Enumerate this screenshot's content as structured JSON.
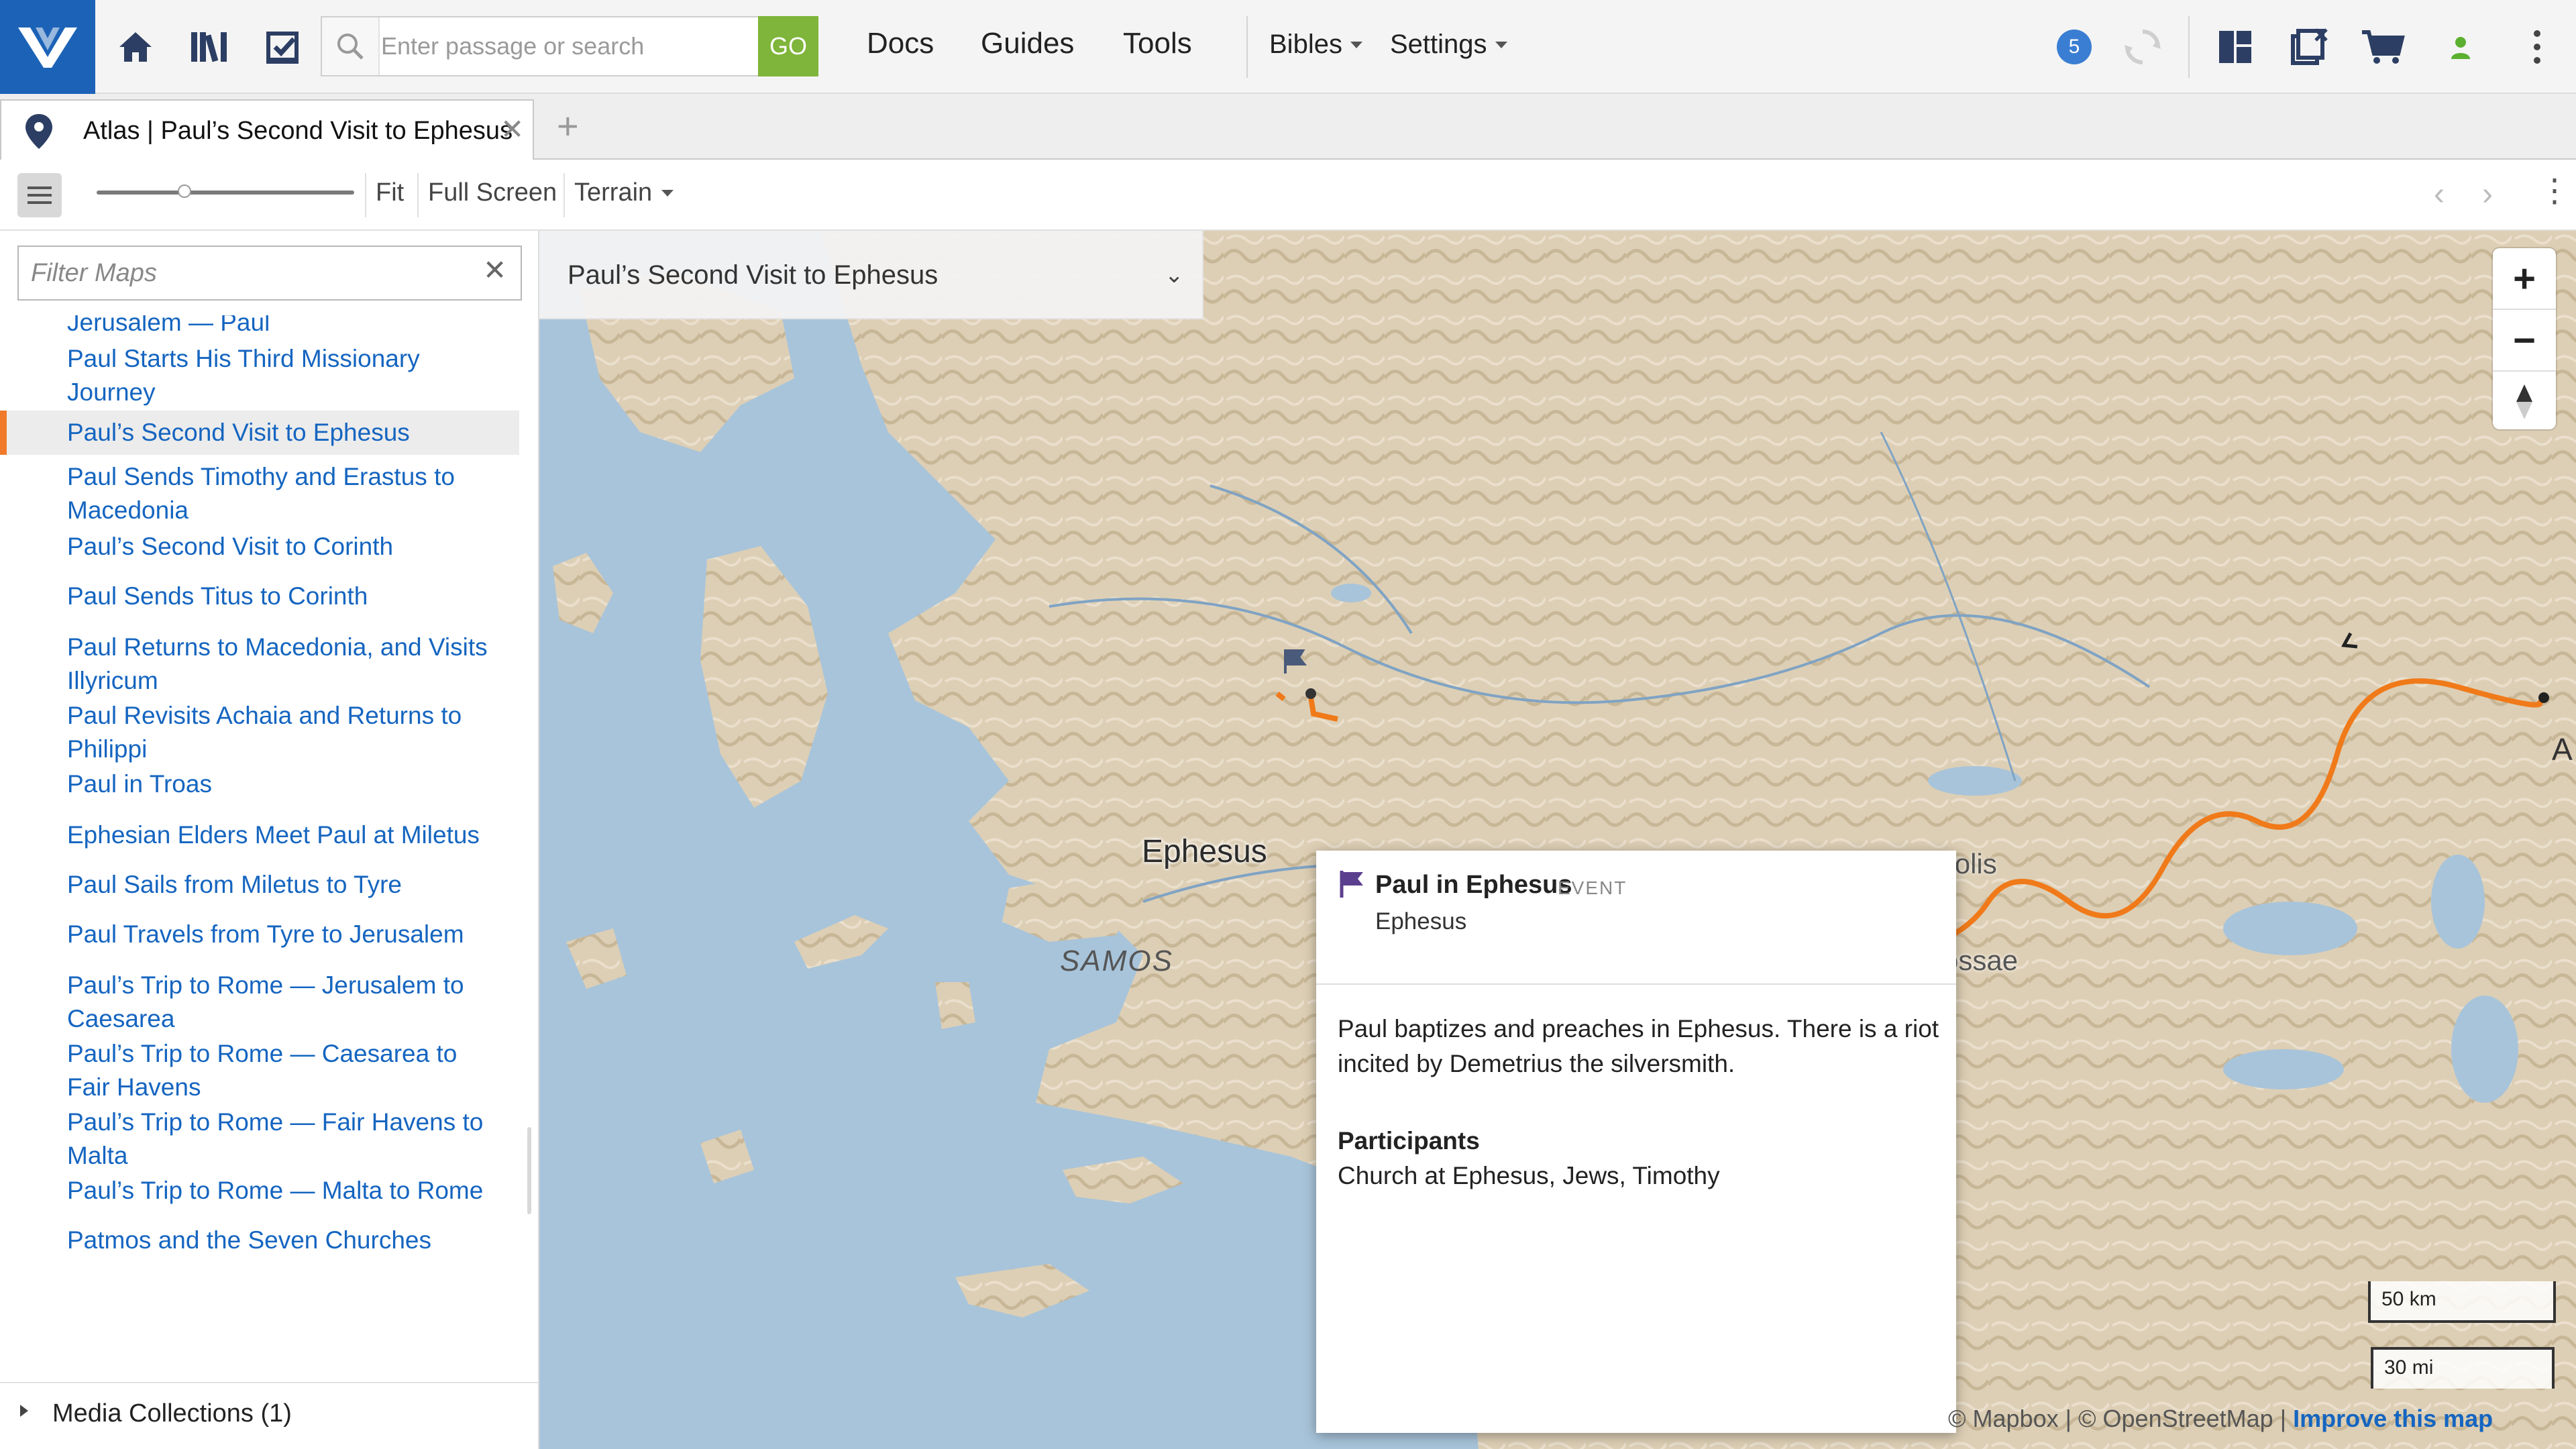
{
  "header": {
    "search_placeholder": "Enter passage or search",
    "go_label": "GO",
    "nav": [
      "Docs",
      "Guides",
      "Tools"
    ],
    "bibles_label": "Bibles",
    "settings_label": "Settings",
    "notification_count": "5"
  },
  "tabs": {
    "active_title": "Atlas | Paul’s Second Visit to Ephesus"
  },
  "toolbar": {
    "zoom_level": 0.34,
    "fit_label": "Fit",
    "fullscreen_label": "Full Screen",
    "terrain_label": "Terrain"
  },
  "sidebar": {
    "filter_placeholder": "Filter Maps",
    "items": [
      {
        "label": "Jerusalem — Paul",
        "active": false
      },
      {
        "label": "Paul Starts His Third Missionary Journey",
        "active": false
      },
      {
        "label": "Paul’s Second Visit to Ephesus",
        "active": true
      },
      {
        "label": "Paul Sends Timothy and Erastus to Macedonia",
        "active": false
      },
      {
        "label": "Paul’s Second Visit to Corinth",
        "active": false
      },
      {
        "label": "Paul Sends Titus to Corinth",
        "active": false
      },
      {
        "label": "Paul Returns to Macedonia, and Visits Illyricum",
        "active": false
      },
      {
        "label": "Paul Revisits Achaia and Returns to Philippi",
        "active": false
      },
      {
        "label": "Paul in Troas",
        "active": false
      },
      {
        "label": "Ephesian Elders Meet Paul at Miletus",
        "active": false
      },
      {
        "label": "Paul Sails from Miletus to Tyre",
        "active": false
      },
      {
        "label": "Paul Travels from Tyre to Jerusalem",
        "active": false
      },
      {
        "label": "Paul’s Trip to Rome — Jerusalem to Caesarea",
        "active": false
      },
      {
        "label": "Paul’s Trip to Rome — Caesarea to Fair Havens",
        "active": false
      },
      {
        "label": "Paul’s Trip to Rome — Fair Havens to Malta",
        "active": false
      },
      {
        "label": "Paul’s Trip to Rome — Malta to Rome",
        "active": false
      },
      {
        "label": "Patmos and the Seven Churches",
        "active": false
      }
    ],
    "media_collections": "Media Collections (1)"
  },
  "map": {
    "title": "Paul’s Second Visit to Ephesus",
    "labels": {
      "ephesus": "Ephesus",
      "samos": "SAMOS",
      "hierapolis": "Hierapolis",
      "colossae": "ossae",
      "edge": "A"
    },
    "scale_km": "50 km",
    "scale_mi": "30 mi",
    "attribution": {
      "mapbox": "© Mapbox",
      "osm": "© OpenStreetMap",
      "separator": "|",
      "improve": "Improve this map"
    },
    "route_color": "#f07a1a"
  },
  "popup": {
    "title": "Paul in Ephesus",
    "type": "EVENT",
    "place": "Ephesus",
    "description": "Paul baptizes and preaches in Ephesus. There is a riot incited by Demetrius the silversmith.",
    "participants_label": "Participants",
    "participants": "Church at Ephesus, Jews, Timothy"
  },
  "colors": {
    "brand": "#1c63b7",
    "go": "#7fb53a",
    "link": "#1565c0",
    "active_marker": "#f07a2a",
    "event_flag": "#5b3f8f"
  }
}
